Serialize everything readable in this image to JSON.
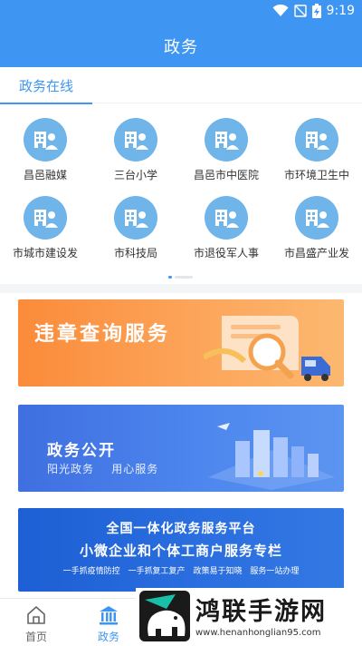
{
  "status_bar": {
    "time": "9:19"
  },
  "header": {
    "title": "政务"
  },
  "section": {
    "tab_label": "政务在线"
  },
  "services": [
    {
      "label": "昌邑融媒"
    },
    {
      "label": "三台小学"
    },
    {
      "label": "昌邑市中医院"
    },
    {
      "label": "市环境卫生中"
    },
    {
      "label": "市城市建设发"
    },
    {
      "label": "市科技局"
    },
    {
      "label": "市退役军人事"
    },
    {
      "label": "市昌盛产业发"
    }
  ],
  "pager": {
    "current": 1,
    "total": 2
  },
  "banners": {
    "violation": {
      "title": "违章查询服务"
    },
    "government": {
      "title": "政务公开",
      "subtitle": "阳光政务    用心服务"
    },
    "platform": {
      "line1": "全国一体化政务服务平台",
      "line2": "小微企业和个体工商户服务专栏",
      "tags": [
        "一手抓疫情防控",
        "一手抓复工复产",
        "政策易于知晓",
        "服务一站办理"
      ]
    }
  },
  "tab_bar": {
    "home_label": "首页",
    "gov_label": "政务",
    "active_color": "#3f96f2",
    "inactive_color": "#666666"
  },
  "watermark": {
    "title": "鸿联手游网",
    "url": "www.henanhonglian95.com"
  },
  "colors": {
    "primary": "#3f96f2",
    "icon_circle": "#6fb5ea"
  }
}
